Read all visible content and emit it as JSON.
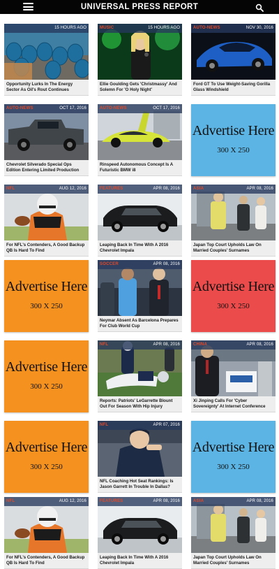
{
  "header": {
    "title": "UNIVERSAL PRESS REPORT",
    "menu_icon": "hamburger-menu-icon",
    "search_icon": "search-icon"
  },
  "articles": [
    {
      "category": "",
      "date": "15 HOURS AGO",
      "title": "Opportunity Lurks In The Energy Sector As Oil's Rout Continues"
    },
    {
      "category": "MUSIC",
      "date": "15 HOURS AGO",
      "title": "Ellie Goulding Gets 'Christmassy' And Solemn For 'O Holy Night'"
    },
    {
      "category": "AUTO-NEWS",
      "date": "NOV 30, 2016",
      "title": "Ford GT To Use Weight-Saving Gorilla Glass Windshield"
    },
    {
      "category": "AUTO-NEWS",
      "date": "OCT 17, 2016",
      "title": "Chevrolet Silverado Special Ops Edition Entering Limited Production"
    },
    {
      "category": "AUTO-NEWS",
      "date": "OCT 17, 2016",
      "title": "Rinspeed Autonomous Concept Is A Futuristic BMW i8"
    },
    {
      "category": "NFL",
      "date": "AUG 12, 2016",
      "title": "For NFL's Contenders, A Good Backup QB Is Hard To Find"
    },
    {
      "category": "FEATURES",
      "date": "APR 08, 2016",
      "title": "Leaping Back In Time With A 2016 Chevrolet Impala"
    },
    {
      "category": "ASIA",
      "date": "APR 08, 2016",
      "title": "Japan Top Court Upholds Law On Married Couples' Surnames"
    },
    {
      "category": "SOCCER",
      "date": "APR 08, 2016",
      "title": "Neymar Absent As Barcelona Prepares For Club World Cup"
    },
    {
      "category": "NFL",
      "date": "APR 08, 2016",
      "title": "Reports: Patriots' LeGarrette Blount Out For Season With Hip Injury"
    },
    {
      "category": "CHINA",
      "date": "APR 08, 2016",
      "title": "Xi Jinping Calls For 'Cyber Sovereignty' At Internet Conference"
    },
    {
      "category": "NFL",
      "date": "APR 07, 2016",
      "title": "NFL Coaching Hot Seat Rankings: Is Jason Garrett In Trouble In Dallas?"
    },
    {
      "category": "NFL",
      "date": "AUG 12, 2016",
      "title": "For NFL's Contenders, A Good Backup QB Is Hard To Find"
    },
    {
      "category": "FEATURES",
      "date": "APR 08, 2016",
      "title": "Leaping Back In Time With A 2016 Chevrolet Impala"
    },
    {
      "category": "ASIA",
      "date": "APR 08, 2016",
      "title": "Japan Top Court Upholds Law On Married Couples' Surnames"
    }
  ],
  "ads": [
    {
      "headline": "Advertise Here",
      "size": "300 X 250",
      "color": "#5bb4e3"
    },
    {
      "headline": "Advertise Here",
      "size": "300 X 250",
      "color": "#f5921f"
    },
    {
      "headline": "Advertise Here",
      "size": "300 X 250",
      "color": "#ec4b4b"
    },
    {
      "headline": "Advertise Here",
      "size": "300 X 250",
      "color": "#f5921f"
    },
    {
      "headline": "Advertise Here",
      "size": "300 X 250",
      "color": "#f5921f"
    },
    {
      "headline": "Advertise Here",
      "size": "300 X 250",
      "color": "#5bb4e3"
    }
  ],
  "colors": {
    "header_bg": "#050505",
    "category_text": "#e24a2a",
    "tag_bar": "#26385c"
  }
}
